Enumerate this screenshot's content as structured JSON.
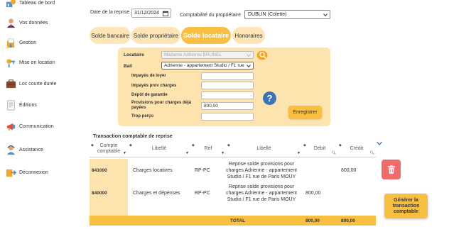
{
  "sidebar": {
    "items": [
      {
        "label": "Tableau de bord",
        "icon": "dashboard-icon"
      },
      {
        "label": "Vos données",
        "icon": "user-icon"
      },
      {
        "label": "Gestion",
        "icon": "gestion-icon"
      },
      {
        "label": "Mise en location",
        "icon": "keys-icon"
      },
      {
        "label": "Loc courte durée",
        "icon": "suitcase-icon"
      },
      {
        "label": "Éditions",
        "icon": "document-icon"
      },
      {
        "label": "Communication",
        "icon": "megaphone-icon"
      },
      {
        "label": "Assistance",
        "icon": "assistance-icon"
      },
      {
        "label": "Déconnexion",
        "icon": "logout-icon"
      }
    ]
  },
  "top": {
    "date_label": "Date de la reprise",
    "date_value": "31/12/2024",
    "owner_label": "Comptabilité du propriétaire",
    "owner_value": "DUBLIN (Colette)"
  },
  "tabs": [
    {
      "label": "Solde bancaire",
      "active": false
    },
    {
      "label": "Solde propriétaire",
      "active": false
    },
    {
      "label": "Solde locataire",
      "active": true
    },
    {
      "label": "Honoraires",
      "active": false
    }
  ],
  "form": {
    "locataire_label": "Locataire",
    "locataire_value": "Madame Adrienne BRUNEL",
    "bail_label": "Bail",
    "bail_value": "Adrienne - appartement Studio / F1 rue",
    "impayes_loyer_label": "Impayés de loyer",
    "impayes_loyer_value": "",
    "impayes_charges_label": "Impayés prov charges",
    "impayes_charges_value": "",
    "depot_label": "Dépôt de garantie",
    "depot_value": "",
    "provisions_label": "Provisions pour charges déjà payées",
    "provisions_value": "800,00",
    "trop_percu_label": "Trop perçu",
    "trop_percu_value": "",
    "help_label": "?",
    "save_label": "Enregistrer"
  },
  "table": {
    "title": "Transaction comptable de reprise",
    "headers": [
      "Compte comptable",
      "Libellé",
      "Réf",
      "Libellé",
      "Débit",
      "Crédit"
    ],
    "rows": [
      {
        "compte": "841000",
        "libelle1": "Charges locatives",
        "ref": "RP-PC",
        "libelle2": "Reprise solde provisions pour charges Adrienne - appartement Studio / F1 rue de Paris MOUY",
        "debit": "",
        "credit": "800,00"
      },
      {
        "compte": "840000",
        "libelle1": "Charges et dépenses",
        "ref": "RP-PC",
        "libelle2": "Reprise solde provisions pour charges Adrienne - appartement Studio / F1 rue de Paris MOUY",
        "debit": "800,00",
        "credit": ""
      }
    ],
    "total_label": "TOTAL",
    "total_debit": "800,00",
    "total_credit": "800,00"
  },
  "actions": {
    "generate_label": "Générer la transaction comptable"
  },
  "colors": {
    "accent": "#f9bf40",
    "panel": "#fde3ae",
    "danger": "#f26b6b",
    "help": "#3b73b9"
  }
}
